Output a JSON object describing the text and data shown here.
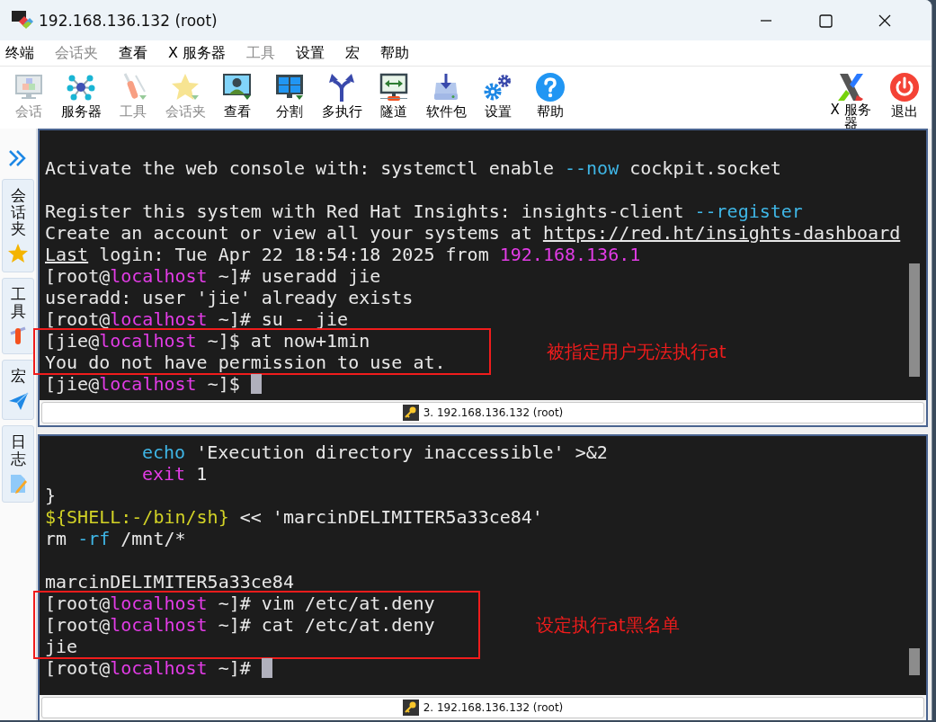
{
  "window": {
    "title": "192.168.136.132 (root)"
  },
  "menu": [
    {
      "label": "终端",
      "disabled": false
    },
    {
      "label": "会话夹",
      "disabled": true
    },
    {
      "label": "查看",
      "disabled": false
    },
    {
      "label": "X 服务器",
      "disabled": false
    },
    {
      "label": "工具",
      "disabled": true
    },
    {
      "label": "设置",
      "disabled": false
    },
    {
      "label": "宏",
      "disabled": false
    },
    {
      "label": "帮助",
      "disabled": false
    }
  ],
  "toolbar": [
    {
      "label": "会话",
      "disabled": true
    },
    {
      "label": "服务器",
      "disabled": false
    },
    {
      "label": "工具",
      "disabled": true
    },
    {
      "label": "会话夹",
      "disabled": true
    },
    {
      "label": "查看",
      "disabled": false
    },
    {
      "label": "分割",
      "disabled": false
    },
    {
      "label": "多执行",
      "disabled": false
    },
    {
      "label": "隧道",
      "disabled": false
    },
    {
      "label": "软件包",
      "disabled": false
    },
    {
      "label": "设置",
      "disabled": false
    },
    {
      "label": "帮助",
      "disabled": false
    }
  ],
  "toolbar_right": [
    {
      "label": "X 服务器"
    },
    {
      "label": "退出"
    }
  ],
  "sidebar": {
    "tabs": [
      {
        "label": "会话夹"
      },
      {
        "label": "工具"
      },
      {
        "label": "宏"
      },
      {
        "label": "日志"
      }
    ]
  },
  "panes": [
    {
      "status": "3. 192.168.136.132 (root)",
      "lines": [
        {
          "kind": "blank"
        },
        {
          "kind": "text",
          "segments": [
            {
              "kind": "plain",
              "text": "Activate the web console with: systemctl enable "
            },
            {
              "kind": "option",
              "text": "--now"
            },
            {
              "kind": "plain",
              "text": " cockpit.socket"
            }
          ]
        },
        {
          "kind": "blank"
        },
        {
          "kind": "text",
          "segments": [
            {
              "kind": "plain",
              "text": "Register this system with Red Hat Insights: insights-client "
            },
            {
              "kind": "option",
              "text": "--register"
            }
          ]
        },
        {
          "kind": "text",
          "segments": [
            {
              "kind": "plain",
              "text": "Create an account or view all your systems at "
            },
            {
              "kind": "underlined",
              "text": "https://red.ht/insights-dashboard"
            }
          ]
        },
        {
          "kind": "text",
          "segments": [
            {
              "kind": "underlined",
              "text": "Last"
            },
            {
              "kind": "plain",
              "text": " login: Tue Apr 22 18:54:18 2025 from "
            },
            {
              "kind": "host",
              "text": "192.168.136.1"
            }
          ]
        },
        {
          "kind": "text",
          "segments": [
            {
              "kind": "plain",
              "text": "[root@"
            },
            {
              "kind": "host",
              "text": "localhost"
            },
            {
              "kind": "plain",
              "text": " ~]# useradd jie"
            }
          ]
        },
        {
          "kind": "text",
          "segments": [
            {
              "kind": "plain",
              "text": "useradd: user 'jie' already exists"
            }
          ]
        },
        {
          "kind": "text",
          "segments": [
            {
              "kind": "plain",
              "text": "[root@"
            },
            {
              "kind": "host",
              "text": "localhost"
            },
            {
              "kind": "plain",
              "text": " ~]# su - jie"
            }
          ]
        },
        {
          "kind": "callout",
          "note": "被指定用户无法执行at",
          "lines": [
            {
              "kind": "text",
              "segments": [
                {
                  "kind": "plain",
                  "text": "[jie@"
                },
                {
                  "kind": "host",
                  "text": "localhost"
                },
                {
                  "kind": "plain",
                  "text": " ~]$ at now+1min"
                }
              ]
            },
            {
              "kind": "text",
              "segments": [
                {
                  "kind": "plain",
                  "text": "You do not have permission to use at."
                }
              ]
            }
          ]
        },
        {
          "kind": "text",
          "cursor": true,
          "segments": [
            {
              "kind": "plain",
              "text": "[jie@"
            },
            {
              "kind": "host",
              "text": "localhost"
            },
            {
              "kind": "plain",
              "text": " ~]$"
            }
          ]
        }
      ]
    },
    {
      "status": "2. 192.168.136.132 (root)",
      "lines": [
        {
          "kind": "indented",
          "segments": [
            {
              "kind": "option",
              "text": "echo"
            },
            {
              "kind": "plain",
              "text": " 'Execution directory inaccessible' >&2"
            }
          ]
        },
        {
          "kind": "indented",
          "segments": [
            {
              "kind": "host",
              "text": "exit"
            },
            {
              "kind": "plain",
              "text": " 1"
            }
          ]
        },
        {
          "kind": "text",
          "segments": [
            {
              "kind": "plain",
              "text": "}"
            }
          ]
        },
        {
          "kind": "text",
          "segments": [
            {
              "kind": "variable",
              "text": "${SHELL:-/bin/sh}"
            },
            {
              "kind": "plain",
              "text": " << 'marcinDELIMITER5a33ce84'"
            }
          ]
        },
        {
          "kind": "text",
          "segments": [
            {
              "kind": "plain",
              "text": "rm "
            },
            {
              "kind": "option",
              "text": "-rf"
            },
            {
              "kind": "plain",
              "text": " /mnt/*"
            }
          ]
        },
        {
          "kind": "blank"
        },
        {
          "kind": "text",
          "segments": [
            {
              "kind": "plain",
              "text": "marcinDELIMITER5a33ce84"
            }
          ]
        },
        {
          "kind": "callout",
          "note": "设定执行at黑名单",
          "lines": [
            {
              "kind": "text",
              "segments": [
                {
                  "kind": "plain",
                  "text": "[root@"
                },
                {
                  "kind": "host",
                  "text": "localhost"
                },
                {
                  "kind": "plain",
                  "text": " ~]# vim /etc/at.deny"
                }
              ]
            },
            {
              "kind": "text",
              "segments": [
                {
                  "kind": "plain",
                  "text": "[root@"
                },
                {
                  "kind": "host",
                  "text": "localhost"
                },
                {
                  "kind": "plain",
                  "text": " ~]# cat /etc/at.deny"
                }
              ]
            },
            {
              "kind": "text",
              "segments": [
                {
                  "kind": "plain",
                  "text": "jie"
                }
              ]
            }
          ]
        },
        {
          "kind": "text",
          "cursor": true,
          "segments": [
            {
              "kind": "plain",
              "text": "[root@"
            },
            {
              "kind": "host",
              "text": "localhost"
            },
            {
              "kind": "plain",
              "text": " ~]#"
            }
          ]
        }
      ]
    }
  ]
}
